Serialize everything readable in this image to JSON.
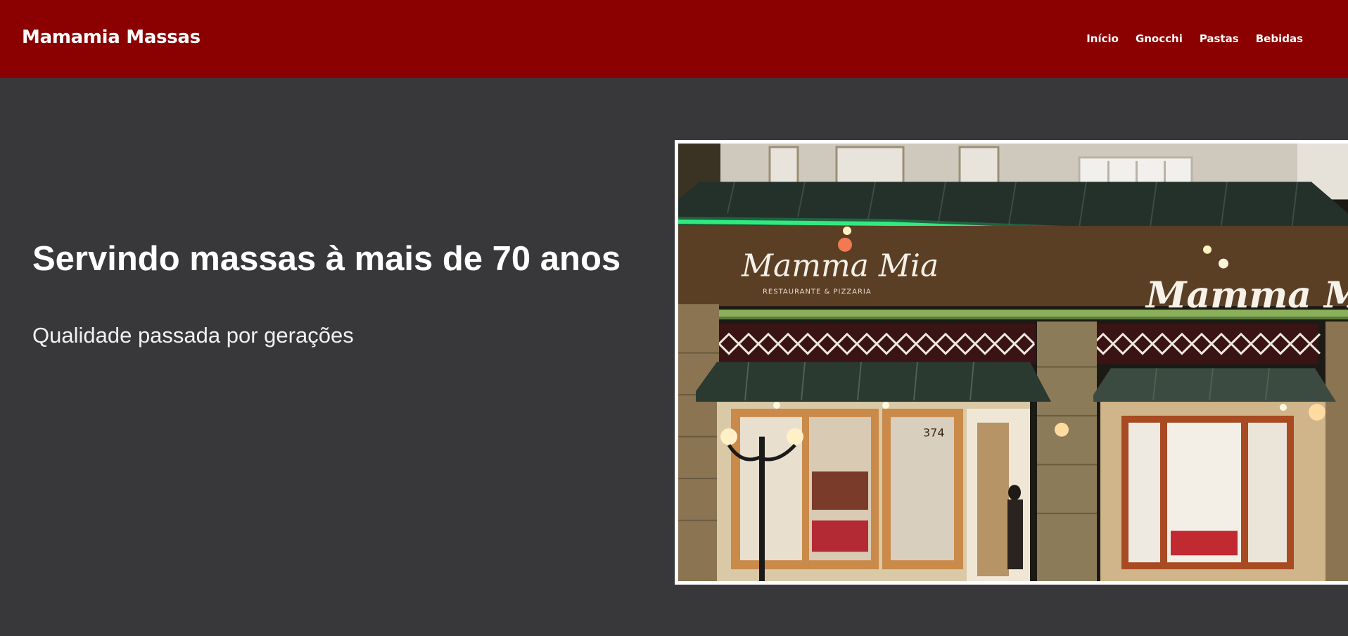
{
  "header": {
    "brand": "Mamamia Massas",
    "nav": [
      {
        "label": "Início"
      },
      {
        "label": "Gnocchi"
      },
      {
        "label": "Pastas"
      },
      {
        "label": "Bebidas"
      }
    ]
  },
  "hero": {
    "title": "Servindo massas à mais de 70 anos",
    "subtitle": "Qualidade passada por gerações",
    "image": {
      "sign_left": "Mamma Mia",
      "sign_left_sub": "RESTAURANTE & PIZZARIA",
      "sign_right": "Mamma Mia",
      "door_number": "374"
    }
  },
  "colors": {
    "header_bg": "#8b0000",
    "page_bg": "#38383a",
    "text": "#ffffff"
  }
}
